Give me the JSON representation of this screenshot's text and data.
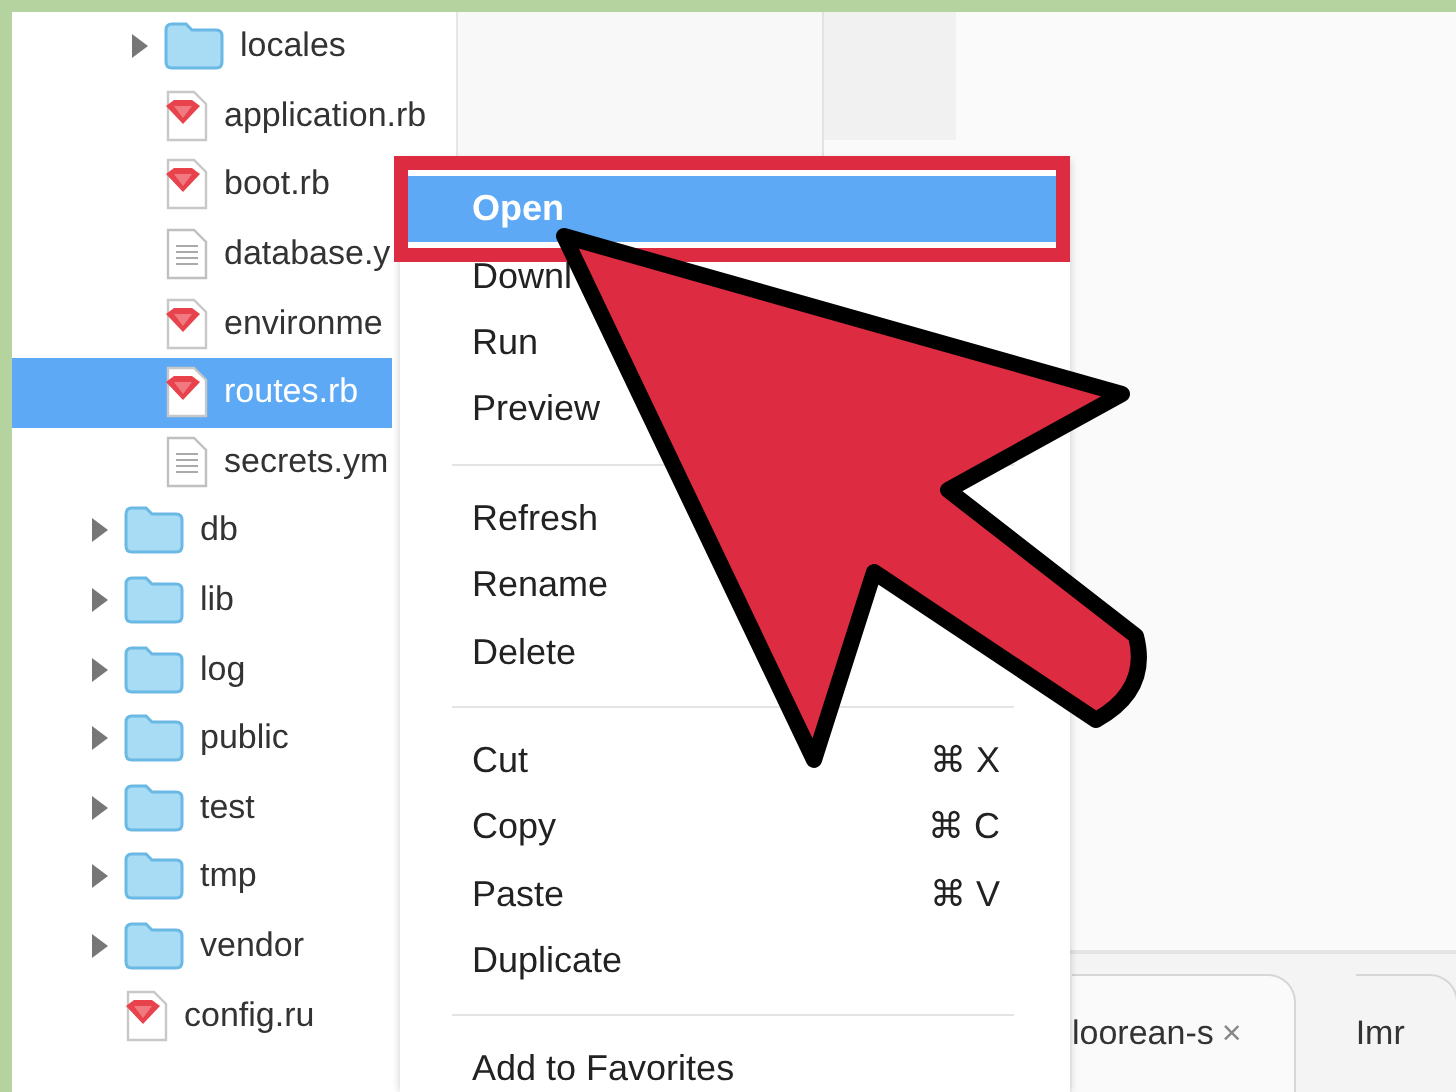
{
  "file_tree": {
    "open_folder_contents": [
      {
        "kind": "folder",
        "label": "locales",
        "expanded": false,
        "selected": false
      },
      {
        "kind": "ruby",
        "label": "application.rb",
        "selected": false
      },
      {
        "kind": "ruby",
        "label": "boot.rb",
        "selected": false
      },
      {
        "kind": "text",
        "label": "database.y",
        "selected": false
      },
      {
        "kind": "ruby",
        "label": "environme",
        "selected": false
      },
      {
        "kind": "ruby",
        "label": "routes.rb",
        "selected": true
      },
      {
        "kind": "text",
        "label": "secrets.ym",
        "selected": false
      }
    ],
    "items": [
      {
        "kind": "folder",
        "label": "db",
        "expanded": false,
        "selected": false
      },
      {
        "kind": "folder",
        "label": "lib",
        "expanded": false,
        "selected": false
      },
      {
        "kind": "folder",
        "label": "log",
        "expanded": false,
        "selected": false
      },
      {
        "kind": "folder",
        "label": "public",
        "expanded": false,
        "selected": false
      },
      {
        "kind": "folder",
        "label": "test",
        "expanded": false,
        "selected": false
      },
      {
        "kind": "folder",
        "label": "tmp",
        "expanded": false,
        "selected": false
      },
      {
        "kind": "folder",
        "label": "vendor",
        "expanded": false,
        "selected": false
      },
      {
        "kind": "ruby",
        "label": "config.ru",
        "selected": false
      }
    ]
  },
  "context_menu": {
    "items": [
      {
        "kind": "item",
        "label": "Open",
        "selected": true
      },
      {
        "kind": "item",
        "label": "Downl",
        "selected": false
      },
      {
        "kind": "item",
        "label": "Run",
        "selected": false
      },
      {
        "kind": "item",
        "label": "Preview",
        "selected": false
      },
      {
        "kind": "separator"
      },
      {
        "kind": "item",
        "label": "Refresh",
        "selected": false
      },
      {
        "kind": "item",
        "label": "Rename",
        "selected": false
      },
      {
        "kind": "item",
        "label": "Delete",
        "selected": false
      },
      {
        "kind": "separator"
      },
      {
        "kind": "item",
        "label": "Cut",
        "shortcut": "⌘ X",
        "selected": false
      },
      {
        "kind": "item",
        "label": "Copy",
        "shortcut": "⌘ C",
        "selected": false
      },
      {
        "kind": "item",
        "label": "Paste",
        "shortcut": "⌘ V",
        "selected": false
      },
      {
        "kind": "item",
        "label": "Duplicate",
        "selected": false
      },
      {
        "kind": "separator"
      },
      {
        "kind": "item",
        "label": "Add to Favorites",
        "selected": false
      }
    ]
  },
  "editor_tabs": [
    {
      "label": "loorean-s",
      "close": "×"
    },
    {
      "label": "Imr"
    }
  ]
}
